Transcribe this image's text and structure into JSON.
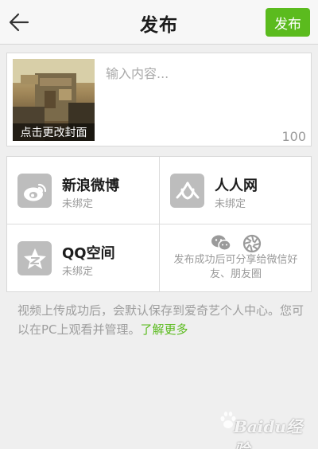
{
  "header": {
    "title": "发布",
    "publish_label": "发布"
  },
  "compose": {
    "cover_label": "点击更改封面",
    "placeholder": "输入内容...",
    "char_count": "100"
  },
  "share": {
    "sina_weibo": {
      "name": "新浪微博",
      "status": "未绑定"
    },
    "renren": {
      "name": "人人网",
      "status": "未绑定"
    },
    "qzone": {
      "name": "QQ空间",
      "status": "未绑定"
    },
    "wechat_hint": "发布成功后可分享给微信好友、朋友圈"
  },
  "note": {
    "text": "视频上传成功后，会默认保存到爱奇艺个人中心。您可以在PC上观看并管理。",
    "link": "了解更多"
  },
  "watermark": {
    "text": "Baidu经验"
  },
  "colors": {
    "accent": "#5bbb1e",
    "icon_gray": "#bdbdbd",
    "background": "#efefef"
  },
  "icons": [
    "back-arrow-icon",
    "weibo-icon",
    "renren-icon",
    "qzone-icon",
    "wechat-icon",
    "moments-icon"
  ]
}
